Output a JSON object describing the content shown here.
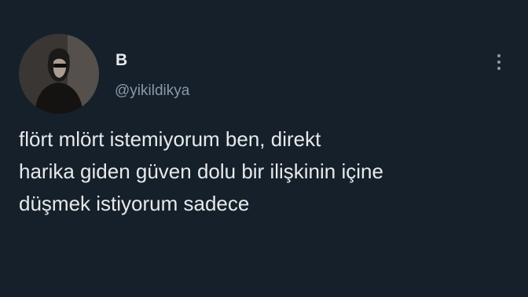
{
  "tweet": {
    "display_name": "B",
    "handle": "@yikildikya",
    "text_lines": [
      "flört mlört istemiyorum ben, direkt",
      "harika giden güven dolu bir ilişkinin içine",
      "düşmek istiyorum sadece"
    ],
    "more_icon": "vertical-ellipsis-icon"
  },
  "colors": {
    "background": "#15202b",
    "primary_text": "#e7e9ea",
    "secondary_text": "#8b98a5"
  }
}
